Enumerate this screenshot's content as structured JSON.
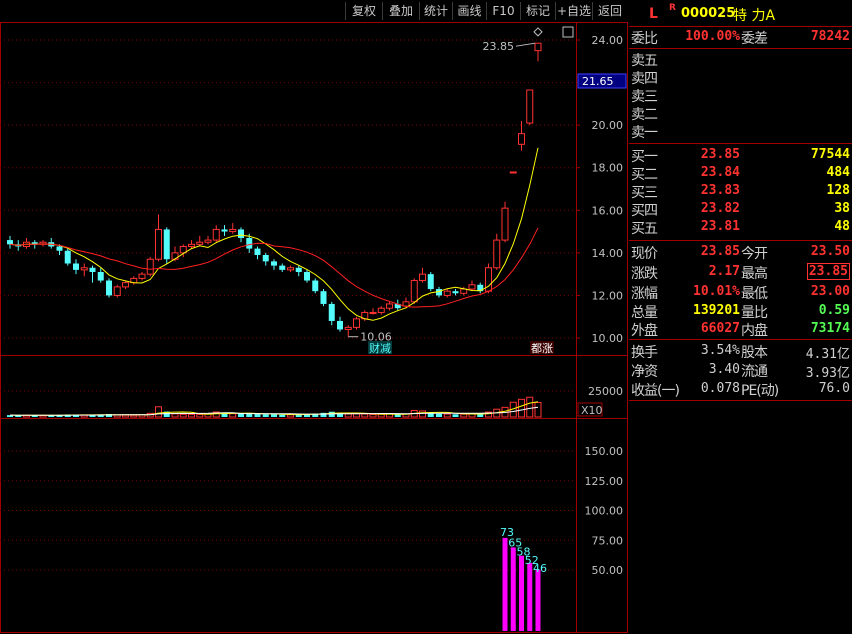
{
  "toolbar": {
    "items": [
      "复权",
      "叠加",
      "统计",
      "画线",
      "F10",
      "标记",
      "+自选",
      "返回"
    ]
  },
  "stock": {
    "flag_l": "L",
    "flag_r": "R",
    "code": "000025",
    "name": "特 力A"
  },
  "price_chart": {
    "y_ticks": [
      "24.00",
      "22.00",
      "20.00",
      "18.00",
      "16.00",
      "14.00",
      "12.00",
      "10.00"
    ],
    "current_price_label": "21.65",
    "high_label": "23.85",
    "low_label": "10.06",
    "left_tag": "财减",
    "right_tag": "都涨"
  },
  "volume_chart": {
    "y_tick": "25000",
    "unit": "X10"
  },
  "indicator_chart": {
    "y_ticks": [
      "150.00",
      "125.00",
      "100.00",
      "75.00",
      "50.00"
    ],
    "bar_labels": [
      "73",
      "65",
      "58",
      "52",
      "46"
    ]
  },
  "quote": {
    "weibi_label": "委比",
    "weibi_value": "100.00%",
    "weicha_label": "委差",
    "weicha_value": "78242",
    "asks": [
      {
        "label": "卖五"
      },
      {
        "label": "卖四"
      },
      {
        "label": "卖三"
      },
      {
        "label": "卖二"
      },
      {
        "label": "卖一"
      }
    ],
    "bids": [
      {
        "label": "买一",
        "price": "23.85",
        "volume": "77544"
      },
      {
        "label": "买二",
        "price": "23.84",
        "volume": "484"
      },
      {
        "label": "买三",
        "price": "23.83",
        "volume": "128"
      },
      {
        "label": "买四",
        "price": "23.82",
        "volume": "38"
      },
      {
        "label": "买五",
        "price": "23.81",
        "volume": "48"
      }
    ],
    "stats": [
      {
        "l1": "现价",
        "v1": "23.85",
        "l2": "今开",
        "v2": "23.50"
      },
      {
        "l1": "涨跌",
        "v1": "2.17",
        "l2": "最高",
        "v2": "23.85"
      },
      {
        "l1": "涨幅",
        "v1": "10.01%",
        "l2": "最低",
        "v2": "23.00"
      },
      {
        "l1": "总量",
        "v1": "139201",
        "l2": "量比",
        "v2": "0.59"
      },
      {
        "l1": "外盘",
        "v1": "66027",
        "l2": "内盘",
        "v2": "73174"
      }
    ],
    "fund": [
      {
        "l1": "换手",
        "v1": "3.54%",
        "l2": "股本",
        "v2": "4.31亿"
      },
      {
        "l1": "净资",
        "v1": "3.40",
        "l2": "流通",
        "v2": "3.93亿"
      },
      {
        "l1": "收益(一)",
        "v1": "0.078",
        "l2": "PE(动)",
        "v2": "76.0"
      }
    ]
  },
  "colors": {
    "up": "#ff3232",
    "down": "#54fcfc",
    "grid": "#7a0000",
    "ma_fast": "#ffff00",
    "ma_slow": "#ff2020",
    "indicator": "#ff00ff"
  }
}
